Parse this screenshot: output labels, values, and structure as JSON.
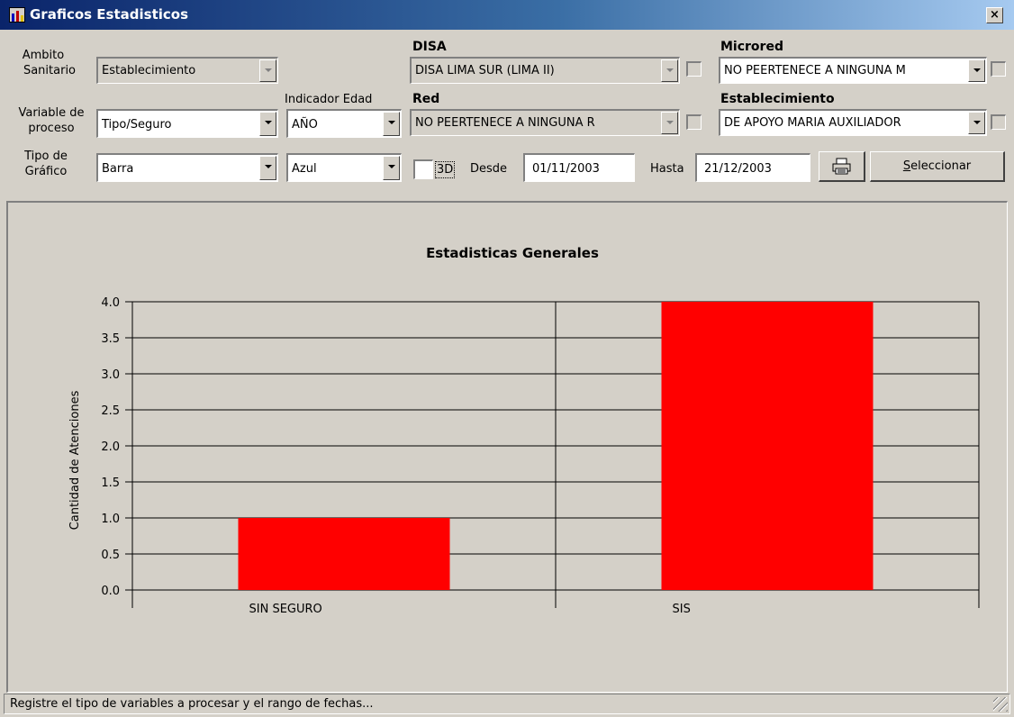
{
  "window": {
    "title": "Graficos Estadisticos",
    "close_label": "×"
  },
  "filters": {
    "ambito": {
      "label_line1": "Ambito",
      "label_line2": "Sanitario",
      "value": "Establecimiento"
    },
    "variable": {
      "label_line1": "Variable de",
      "label_line2": "proceso",
      "value": "Tipo/Seguro"
    },
    "indicador": {
      "label": "Indicador Edad",
      "value": "AÑO"
    },
    "tipo_grafico": {
      "label_line1": "Tipo de",
      "label_line2": "Gráfico",
      "value": "Barra"
    },
    "color": {
      "value": "Azul"
    },
    "disa": {
      "label": "DISA",
      "value": "DISA LIMA SUR (LIMA II)"
    },
    "red": {
      "label": "Red",
      "value": "NO PEERTENECE A NINGUNA R"
    },
    "microred": {
      "label": "Microred",
      "value": "NO PEERTENECE A NINGUNA M"
    },
    "establecimiento": {
      "label": "Establecimiento",
      "value": "DE APOYO MARIA AUXILIADOR"
    },
    "three_d": {
      "label": "3D",
      "checked": false
    },
    "desde": {
      "label": "Desde",
      "value": "01/11/2003"
    },
    "hasta": {
      "label": "Hasta",
      "value": "21/12/2003"
    }
  },
  "buttons": {
    "print_icon": "printer-icon",
    "seleccionar_first": "S",
    "seleccionar_rest": "eleccionar"
  },
  "chart_data": {
    "type": "bar",
    "title": "Estadisticas Generales",
    "xlabel": "",
    "ylabel": "Cantidad de Atenciones",
    "categories": [
      "SIN SEGURO",
      "SIS"
    ],
    "values": [
      1,
      4
    ],
    "ylim": [
      0,
      4
    ],
    "yticks": [
      "0.0",
      "0.5",
      "1.0",
      "1.5",
      "2.0",
      "2.5",
      "3.0",
      "3.5",
      "4.0"
    ],
    "bar_color": "#ff0000",
    "grid": true
  },
  "status": {
    "text": "Registre el tipo de variables a procesar y el rango de fechas..."
  }
}
